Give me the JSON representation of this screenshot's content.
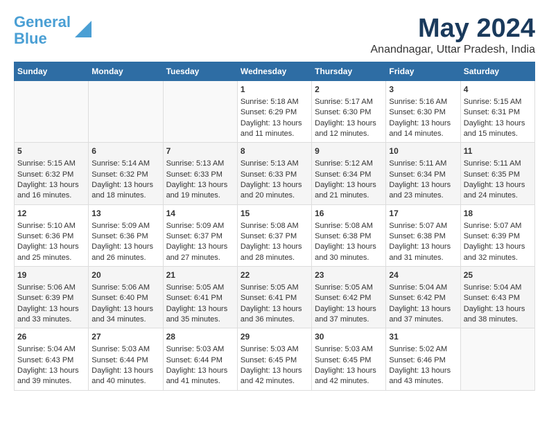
{
  "logo": {
    "line1": "General",
    "line2": "Blue"
  },
  "title": "May 2024",
  "subtitle": "Anandnagar, Uttar Pradesh, India",
  "weekdays": [
    "Sunday",
    "Monday",
    "Tuesday",
    "Wednesday",
    "Thursday",
    "Friday",
    "Saturday"
  ],
  "weeks": [
    [
      {
        "day": "",
        "sunrise": "",
        "sunset": "",
        "daylight": ""
      },
      {
        "day": "",
        "sunrise": "",
        "sunset": "",
        "daylight": ""
      },
      {
        "day": "",
        "sunrise": "",
        "sunset": "",
        "daylight": ""
      },
      {
        "day": "1",
        "sunrise": "Sunrise: 5:18 AM",
        "sunset": "Sunset: 6:29 PM",
        "daylight": "Daylight: 13 hours and 11 minutes."
      },
      {
        "day": "2",
        "sunrise": "Sunrise: 5:17 AM",
        "sunset": "Sunset: 6:30 PM",
        "daylight": "Daylight: 13 hours and 12 minutes."
      },
      {
        "day": "3",
        "sunrise": "Sunrise: 5:16 AM",
        "sunset": "Sunset: 6:30 PM",
        "daylight": "Daylight: 13 hours and 14 minutes."
      },
      {
        "day": "4",
        "sunrise": "Sunrise: 5:15 AM",
        "sunset": "Sunset: 6:31 PM",
        "daylight": "Daylight: 13 hours and 15 minutes."
      }
    ],
    [
      {
        "day": "5",
        "sunrise": "Sunrise: 5:15 AM",
        "sunset": "Sunset: 6:32 PM",
        "daylight": "Daylight: 13 hours and 16 minutes."
      },
      {
        "day": "6",
        "sunrise": "Sunrise: 5:14 AM",
        "sunset": "Sunset: 6:32 PM",
        "daylight": "Daylight: 13 hours and 18 minutes."
      },
      {
        "day": "7",
        "sunrise": "Sunrise: 5:13 AM",
        "sunset": "Sunset: 6:33 PM",
        "daylight": "Daylight: 13 hours and 19 minutes."
      },
      {
        "day": "8",
        "sunrise": "Sunrise: 5:13 AM",
        "sunset": "Sunset: 6:33 PM",
        "daylight": "Daylight: 13 hours and 20 minutes."
      },
      {
        "day": "9",
        "sunrise": "Sunrise: 5:12 AM",
        "sunset": "Sunset: 6:34 PM",
        "daylight": "Daylight: 13 hours and 21 minutes."
      },
      {
        "day": "10",
        "sunrise": "Sunrise: 5:11 AM",
        "sunset": "Sunset: 6:34 PM",
        "daylight": "Daylight: 13 hours and 23 minutes."
      },
      {
        "day": "11",
        "sunrise": "Sunrise: 5:11 AM",
        "sunset": "Sunset: 6:35 PM",
        "daylight": "Daylight: 13 hours and 24 minutes."
      }
    ],
    [
      {
        "day": "12",
        "sunrise": "Sunrise: 5:10 AM",
        "sunset": "Sunset: 6:36 PM",
        "daylight": "Daylight: 13 hours and 25 minutes."
      },
      {
        "day": "13",
        "sunrise": "Sunrise: 5:09 AM",
        "sunset": "Sunset: 6:36 PM",
        "daylight": "Daylight: 13 hours and 26 minutes."
      },
      {
        "day": "14",
        "sunrise": "Sunrise: 5:09 AM",
        "sunset": "Sunset: 6:37 PM",
        "daylight": "Daylight: 13 hours and 27 minutes."
      },
      {
        "day": "15",
        "sunrise": "Sunrise: 5:08 AM",
        "sunset": "Sunset: 6:37 PM",
        "daylight": "Daylight: 13 hours and 28 minutes."
      },
      {
        "day": "16",
        "sunrise": "Sunrise: 5:08 AM",
        "sunset": "Sunset: 6:38 PM",
        "daylight": "Daylight: 13 hours and 30 minutes."
      },
      {
        "day": "17",
        "sunrise": "Sunrise: 5:07 AM",
        "sunset": "Sunset: 6:38 PM",
        "daylight": "Daylight: 13 hours and 31 minutes."
      },
      {
        "day": "18",
        "sunrise": "Sunrise: 5:07 AM",
        "sunset": "Sunset: 6:39 PM",
        "daylight": "Daylight: 13 hours and 32 minutes."
      }
    ],
    [
      {
        "day": "19",
        "sunrise": "Sunrise: 5:06 AM",
        "sunset": "Sunset: 6:39 PM",
        "daylight": "Daylight: 13 hours and 33 minutes."
      },
      {
        "day": "20",
        "sunrise": "Sunrise: 5:06 AM",
        "sunset": "Sunset: 6:40 PM",
        "daylight": "Daylight: 13 hours and 34 minutes."
      },
      {
        "day": "21",
        "sunrise": "Sunrise: 5:05 AM",
        "sunset": "Sunset: 6:41 PM",
        "daylight": "Daylight: 13 hours and 35 minutes."
      },
      {
        "day": "22",
        "sunrise": "Sunrise: 5:05 AM",
        "sunset": "Sunset: 6:41 PM",
        "daylight": "Daylight: 13 hours and 36 minutes."
      },
      {
        "day": "23",
        "sunrise": "Sunrise: 5:05 AM",
        "sunset": "Sunset: 6:42 PM",
        "daylight": "Daylight: 13 hours and 37 minutes."
      },
      {
        "day": "24",
        "sunrise": "Sunrise: 5:04 AM",
        "sunset": "Sunset: 6:42 PM",
        "daylight": "Daylight: 13 hours and 37 minutes."
      },
      {
        "day": "25",
        "sunrise": "Sunrise: 5:04 AM",
        "sunset": "Sunset: 6:43 PM",
        "daylight": "Daylight: 13 hours and 38 minutes."
      }
    ],
    [
      {
        "day": "26",
        "sunrise": "Sunrise: 5:04 AM",
        "sunset": "Sunset: 6:43 PM",
        "daylight": "Daylight: 13 hours and 39 minutes."
      },
      {
        "day": "27",
        "sunrise": "Sunrise: 5:03 AM",
        "sunset": "Sunset: 6:44 PM",
        "daylight": "Daylight: 13 hours and 40 minutes."
      },
      {
        "day": "28",
        "sunrise": "Sunrise: 5:03 AM",
        "sunset": "Sunset: 6:44 PM",
        "daylight": "Daylight: 13 hours and 41 minutes."
      },
      {
        "day": "29",
        "sunrise": "Sunrise: 5:03 AM",
        "sunset": "Sunset: 6:45 PM",
        "daylight": "Daylight: 13 hours and 42 minutes."
      },
      {
        "day": "30",
        "sunrise": "Sunrise: 5:03 AM",
        "sunset": "Sunset: 6:45 PM",
        "daylight": "Daylight: 13 hours and 42 minutes."
      },
      {
        "day": "31",
        "sunrise": "Sunrise: 5:02 AM",
        "sunset": "Sunset: 6:46 PM",
        "daylight": "Daylight: 13 hours and 43 minutes."
      },
      {
        "day": "",
        "sunrise": "",
        "sunset": "",
        "daylight": ""
      }
    ]
  ]
}
